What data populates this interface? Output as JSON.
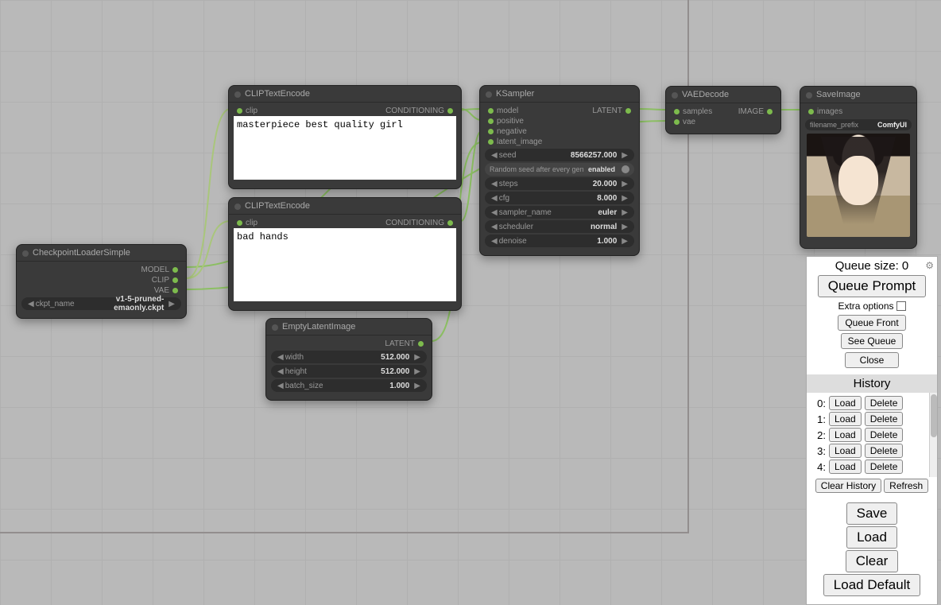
{
  "checkpoint": {
    "title": "CheckpointLoaderSimple",
    "outModel": "MODEL",
    "outClip": "CLIP",
    "outVae": "VAE",
    "ckpt_name_label": "ckpt_name",
    "ckpt_name_value": "v1-5-pruned-emaonly.ckpt"
  },
  "clipPos": {
    "title": "CLIPTextEncode",
    "inClip": "clip",
    "outCond": "CONDITIONING",
    "prompt": "masterpiece best quality girl"
  },
  "clipNeg": {
    "title": "CLIPTextEncode",
    "inClip": "clip",
    "outCond": "CONDITIONING",
    "prompt": "bad hands"
  },
  "empty": {
    "title": "EmptyLatentImage",
    "outLatent": "LATENT",
    "width_label": "width",
    "width_value": "512.000",
    "height_label": "height",
    "height_value": "512.000",
    "batch_label": "batch_size",
    "batch_value": "1.000"
  },
  "ksampler": {
    "title": "KSampler",
    "inModel": "model",
    "inPositive": "positive",
    "inNegative": "negative",
    "inLatent": "latent_image",
    "outLatent": "LATENT",
    "seed_label": "seed",
    "seed_value": "8566257.000",
    "rand_label": "Random seed after every gen",
    "rand_value": "enabled",
    "steps_label": "steps",
    "steps_value": "20.000",
    "cfg_label": "cfg",
    "cfg_value": "8.000",
    "sampler_label": "sampler_name",
    "sampler_value": "euler",
    "sched_label": "scheduler",
    "sched_value": "normal",
    "denoise_label": "denoise",
    "denoise_value": "1.000"
  },
  "vaedecode": {
    "title": "VAEDecode",
    "inSamples": "samples",
    "inVae": "vae",
    "outImage": "IMAGE"
  },
  "saveimage": {
    "title": "SaveImage",
    "inImages": "images",
    "prefix_label": "filename_prefix",
    "prefix_value": "ComfyUI"
  },
  "panel": {
    "queue_size_label": "Queue size: 0",
    "queue_prompt": "Queue Prompt",
    "extra_options": "Extra options",
    "queue_front": "Queue Front",
    "see_queue": "See Queue",
    "close": "Close",
    "history": "History",
    "clear_history": "Clear History",
    "refresh": "Refresh",
    "save": "Save",
    "load": "Load",
    "clear": "Clear",
    "load_default": "Load Default",
    "hist_items": [
      {
        "idx": "0:",
        "load": "Load",
        "del": "Delete"
      },
      {
        "idx": "1:",
        "load": "Load",
        "del": "Delete"
      },
      {
        "idx": "2:",
        "load": "Load",
        "del": "Delete"
      },
      {
        "idx": "3:",
        "load": "Load",
        "del": "Delete"
      },
      {
        "idx": "4:",
        "load": "Load",
        "del": "Delete"
      }
    ]
  }
}
